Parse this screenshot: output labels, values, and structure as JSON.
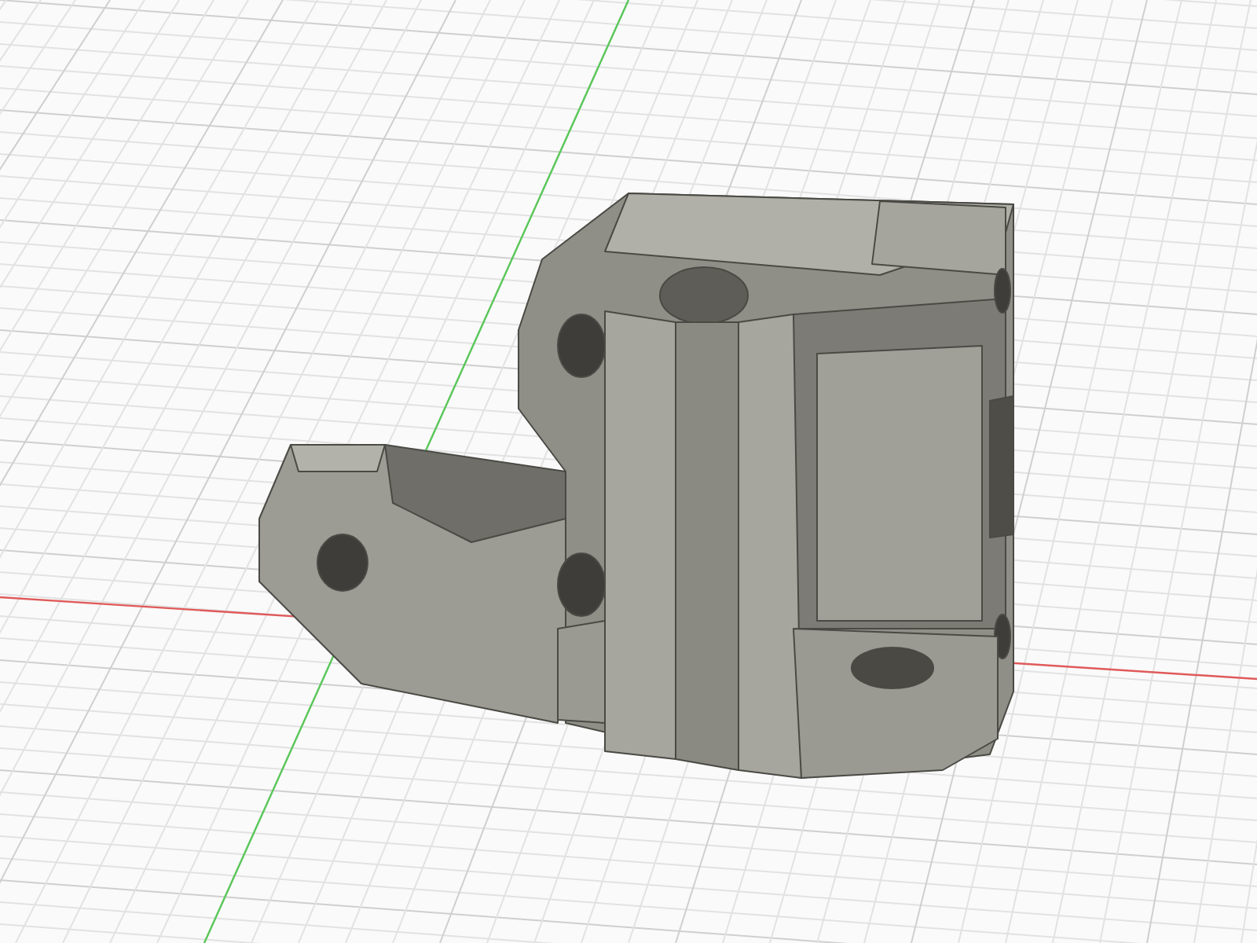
{
  "viewport": {
    "grid": true,
    "axes": true,
    "model": true
  }
}
